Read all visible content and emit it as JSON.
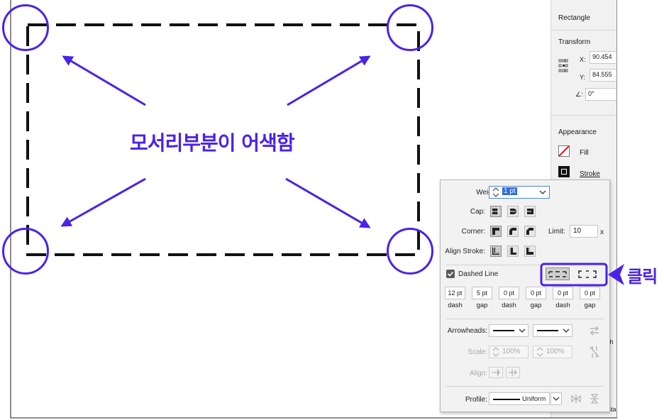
{
  "right_panel": {
    "title": "Rectangle",
    "transform_label": "Transform",
    "x_label": "X:",
    "x_value": "90.454",
    "y_label": "Y:",
    "y_value": "84.555",
    "angle_label": "∠:",
    "angle_value": "0°",
    "appearance_label": "Appearance",
    "fill_label": "Fill",
    "stroke_label": "Stroke",
    "partial_1": "th",
    "partial_2": "Sta"
  },
  "stroke_popup": {
    "weight_label": "Weight:",
    "weight_value": "1 pt",
    "cap_label": "Cap:",
    "corner_label": "Corner:",
    "limit_label": "Limit:",
    "limit_value": "10",
    "limit_unit": "x",
    "align_label": "Align Stroke:",
    "dashed_label": "Dashed Line",
    "dashed_checked": true,
    "dash_values": [
      "12 pt",
      "5 pt",
      "0 pt",
      "0 pt",
      "0 pt",
      "0 pt"
    ],
    "dash_labels": [
      "dash",
      "gap",
      "dash",
      "gap",
      "dash",
      "gap"
    ],
    "arrowheads_label": "Arrowheads:",
    "scale_label": "Scale:",
    "scale_start": "100%",
    "scale_end": "100%",
    "align_arrows_label": "Align:",
    "profile_label": "Profile:",
    "profile_value": "Uniform"
  },
  "annotations": {
    "corner_text": "모서리부분이 어색함",
    "click_text": "클릭",
    "accent_color": "#4a22ea"
  }
}
